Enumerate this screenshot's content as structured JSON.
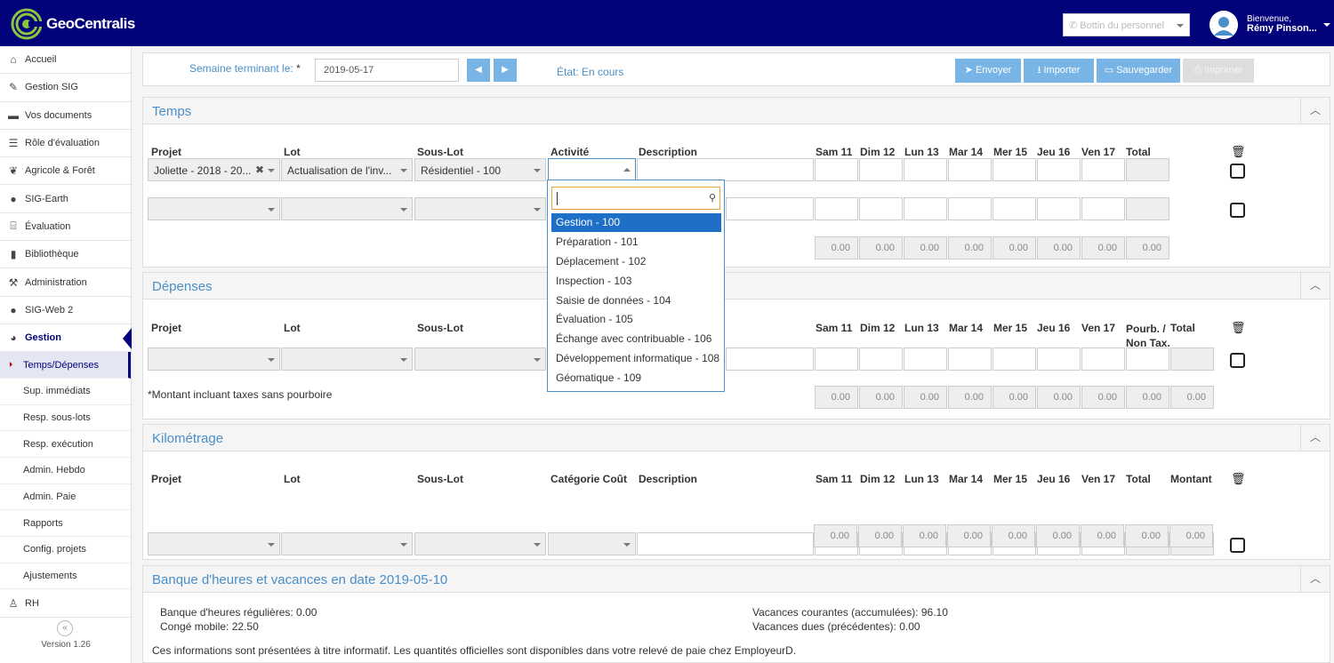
{
  "header": {
    "app_name": "GeoCentralis",
    "employee_select_placeholder": "Bottin du personnel",
    "welcome": "Bienvenue,",
    "user_name": "Rémy Pinson..."
  },
  "sidebar": {
    "items": [
      {
        "label": "Accueil",
        "icon": "home-icon"
      },
      {
        "label": "Gestion SIG",
        "icon": "edit-icon"
      },
      {
        "label": "Vos documents",
        "icon": "folder-icon"
      },
      {
        "label": "Rôle d'évaluation",
        "icon": "list-icon"
      },
      {
        "label": "Agricole & Forêt",
        "icon": "leaf-icon"
      },
      {
        "label": "SIG-Earth",
        "icon": "globe-icon"
      },
      {
        "label": "Évaluation",
        "icon": "bank-icon"
      },
      {
        "label": "Bibliothèque",
        "icon": "book-icon"
      },
      {
        "label": "Administration",
        "icon": "wrench-icon"
      },
      {
        "label": "SIG-Web 2",
        "icon": "globe-icon"
      },
      {
        "label": "Gestion",
        "icon": "dashboard-icon"
      }
    ],
    "subitems": [
      "Temps/Dépenses",
      "Sup. immédiats",
      "Resp. sous-lots",
      "Resp. exécution",
      "Admin. Hebdo",
      "Admin. Paie",
      "Rapports",
      "Config. projets",
      "Ajustements"
    ],
    "rh": "RH",
    "version": "Version 1.26"
  },
  "toolbar": {
    "week_label": "Semaine terminant le:",
    "required_mark": "*",
    "week_date": "2019-05-17",
    "state": "État: En cours",
    "send": "Envoyer",
    "import": "Importer",
    "save": "Sauvegarder",
    "print": "Imprimer"
  },
  "days": [
    "Sam 11",
    "Dim 12",
    "Lun 13",
    "Mar 14",
    "Mer 15",
    "Jeu 16",
    "Ven 17"
  ],
  "temps": {
    "title": "Temps",
    "headers": {
      "projet": "Projet",
      "lot": "Lot",
      "souslot": "Sous-Lot",
      "activite": "Activité",
      "description": "Description",
      "total": "Total"
    },
    "row1": {
      "projet": "Joliette - 2018 - 20...",
      "lot": "Actualisation de l'inv...",
      "souslot": "Résidentiel - 100"
    },
    "totals": [
      "0.00",
      "0.00",
      "0.00",
      "0.00",
      "0.00",
      "0.00",
      "0.00",
      "0.00"
    ]
  },
  "depenses": {
    "title": "Dépenses",
    "headers": {
      "projet": "Projet",
      "lot": "Lot",
      "souslot": "Sous-Lot",
      "pourb": "Pourb. / Non Tax.",
      "total": "Total"
    },
    "note": "*Montant incluant taxes sans pourboire",
    "totals": [
      "0.00",
      "0.00",
      "0.00",
      "0.00",
      "0.00",
      "0.00",
      "0.00",
      "0.00",
      "0.00"
    ]
  },
  "kilometrage": {
    "title": "Kilométrage",
    "headers": {
      "projet": "Projet",
      "lot": "Lot",
      "souslot": "Sous-Lot",
      "categorie": "Catégorie Coût",
      "description": "Description",
      "total": "Total",
      "montant": "Montant"
    },
    "totals": [
      "0.00",
      "0.00",
      "0.00",
      "0.00",
      "0.00",
      "0.00",
      "0.00",
      "0.00",
      "0.00"
    ]
  },
  "banque": {
    "title": "Banque d'heures et vacances en date 2019-05-10",
    "heures": "Banque d'heures régulières: 0.00",
    "conge": "Congé mobile: 22.50",
    "vacances_courantes": "Vacances courantes (accumulées): 96.10",
    "vacances_dues": "Vacances dues (précédentes): 0.00",
    "info": "Ces informations sont présentées à titre informatif. Les quantités officielles sont disponibles dans votre relevé de paie chez EmployeurD."
  },
  "activity_dropdown": {
    "options": [
      "Gestion - 100",
      "Préparation - 101",
      "Déplacement - 102",
      "Inspection - 103",
      "Saisie de données - 104",
      "Évaluation - 105",
      "Échange avec contribuable - 106",
      "Développement informatique - 108",
      "Géomatique - 109"
    ],
    "highlighted": "Gestion - 100"
  },
  "colors": {
    "header_bg": "#02027a",
    "accent": "#4a8fc9",
    "button": "#79b4e6",
    "highlight": "#1f6fc9"
  }
}
